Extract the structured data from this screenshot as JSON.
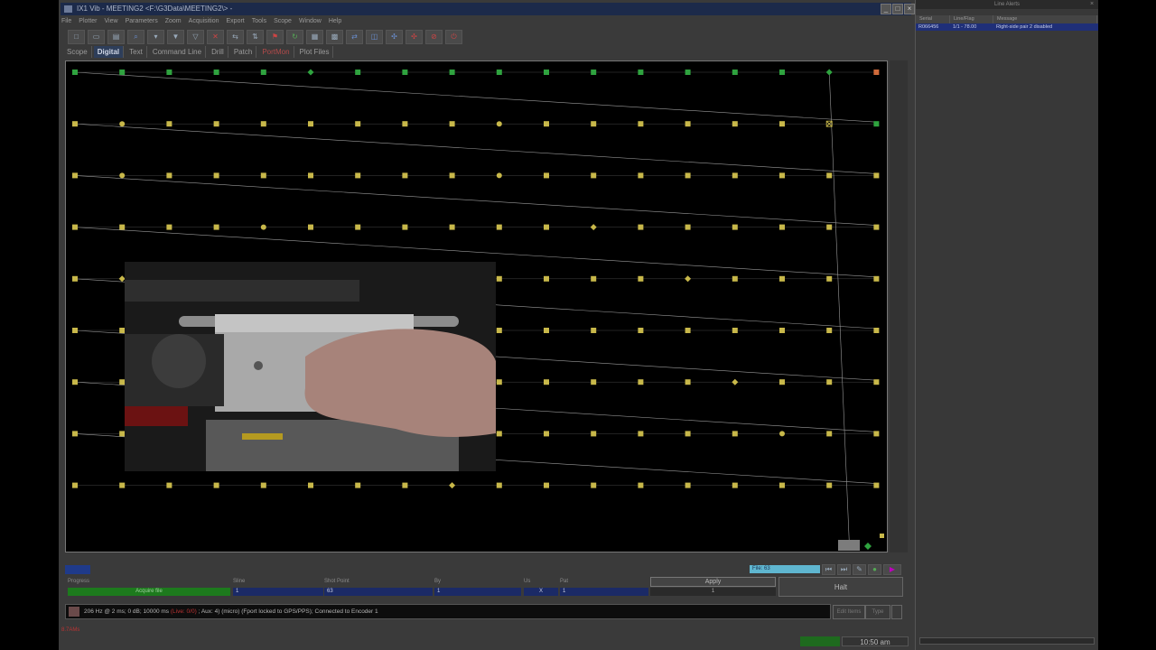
{
  "window": {
    "title": "IX1 Vib - MEETING2 <F:\\G3Data\\MEETING2\\> -"
  },
  "menu": [
    "File",
    "Plotter",
    "View",
    "Parameters",
    "Zoom",
    "Acquisition",
    "Export",
    "Tools",
    "Scope",
    "Window",
    "Help"
  ],
  "toolbar_icons": [
    "new-icon",
    "open-icon",
    "print-icon",
    "zoom-icon",
    "select-icon",
    "filter-icon",
    "filter-alt-icon",
    "grid-icon",
    "link-icon",
    "merge-icon",
    "flag-icon",
    "refresh-icon",
    "spread-icon",
    "patch-icon",
    "transfer-icon",
    "survey-icon",
    "network-icon",
    "settings-net-icon",
    "no-signal-icon",
    "stop-icon"
  ],
  "tabs": [
    {
      "label": "Scope",
      "state": "normal"
    },
    {
      "label": "Digital",
      "state": "active"
    },
    {
      "label": "Text",
      "state": "normal"
    },
    {
      "label": "Command Line",
      "state": "normal"
    },
    {
      "label": "Drill",
      "state": "normal"
    },
    {
      "label": "Patch",
      "state": "normal"
    },
    {
      "label": "PortMon",
      "state": "red"
    },
    {
      "label": "Plot Files",
      "state": "normal"
    }
  ],
  "grid": {
    "columns": 18,
    "rows": 9,
    "colors": {
      "green": "#2fa33f",
      "yellow": "#c8b84a",
      "orange": "#d06a3a",
      "line": "#9a9a9a"
    },
    "row_colors": [
      "green",
      "yellow",
      "yellow",
      "yellow",
      "yellow",
      "yellow",
      "yellow",
      "yellow",
      "yellow"
    ],
    "last_column_green_rows": [
      1
    ],
    "orange_cell": {
      "row": 0,
      "col": 17
    },
    "round_markers": [
      [
        1,
        1
      ],
      [
        1,
        9
      ],
      [
        2,
        1
      ],
      [
        2,
        9
      ],
      [
        3,
        4
      ],
      [
        7,
        15
      ]
    ],
    "diamond_markers": [
      [
        0,
        5
      ],
      [
        0,
        16
      ],
      [
        3,
        11
      ],
      [
        4,
        1
      ],
      [
        4,
        13
      ],
      [
        6,
        14
      ],
      [
        8,
        8
      ]
    ],
    "cross_marker": [
      1,
      16
    ]
  },
  "bottom": {
    "file_label": "File: 63",
    "progress_label": "Progress",
    "progress_value": "Acquire file",
    "sline_label": "Sline",
    "sline_value": "1",
    "shot_label": "Shot Point",
    "shot_value": "63",
    "by_label": "By",
    "by_value": "1",
    "us_label": "Us",
    "us_value": "X",
    "pat_label": "Pat",
    "pat_value": "1",
    "apply_label": "Apply",
    "apply_value": "1",
    "halt_label": "Halt"
  },
  "status": {
    "text": "206 Hz @ 2 ms; 0 dB; 10000 ms",
    "live": "(Live: 0/0)",
    "rest": "; Aux: 4) (micro) (Fport locked to GPS/PPS);  Connected to Encoder 1",
    "edit_label": "Edit Items",
    "type_label": "Type",
    "footer_left": "8.7AMs",
    "time": "10:50 am"
  },
  "alerts_panel": {
    "title": "Line Alerts",
    "columns": [
      "Serial",
      "Line/Flag",
      "Message"
    ],
    "rows": [
      {
        "serial": "R066456",
        "line": "1/1 - 78.00",
        "message": "Right-side pair 2 disabled"
      }
    ]
  }
}
